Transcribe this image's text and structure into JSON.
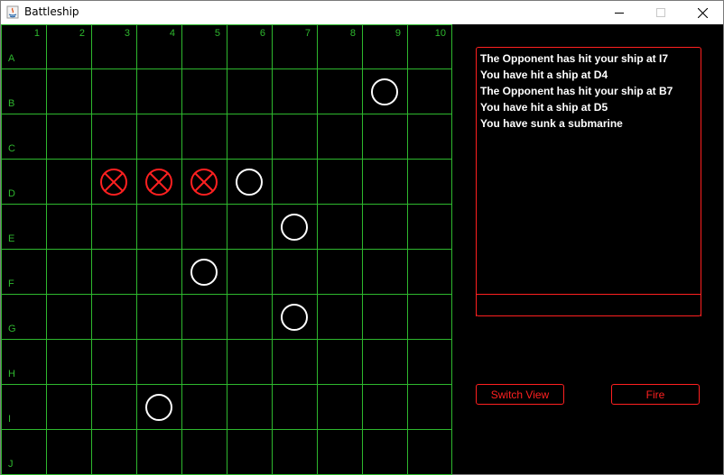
{
  "window": {
    "title": "Battleship",
    "accent_color": "#2eb82e",
    "hit_color": "#ff2020",
    "miss_color": "#ffffff"
  },
  "board": {
    "columns": [
      "1",
      "2",
      "3",
      "4",
      "5",
      "6",
      "7",
      "8",
      "9",
      "10"
    ],
    "rows": [
      "A",
      "B",
      "C",
      "D",
      "E",
      "F",
      "G",
      "H",
      "I",
      "J"
    ],
    "hits": [
      "D3",
      "D4",
      "D5"
    ],
    "misses": [
      "B9",
      "D6",
      "E7",
      "F5",
      "G7",
      "I4"
    ]
  },
  "log": {
    "lines": [
      "The Opponent has hit your ship at I7",
      "You have hit a ship at D4",
      "The Opponent has hit your ship at B7",
      "You have hit a ship at D5",
      "You have sunk a submarine"
    ],
    "input_value": ""
  },
  "buttons": {
    "switch_view": "Switch View",
    "fire": "Fire"
  }
}
